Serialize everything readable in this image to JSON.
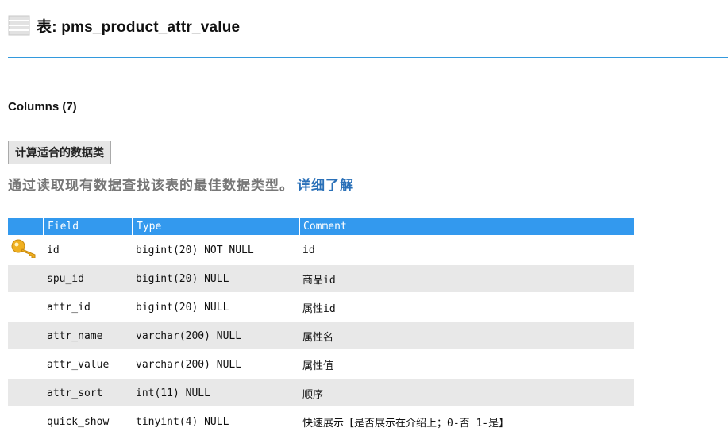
{
  "header": {
    "title": "表: pms_product_attr_value",
    "icon": "table-icon"
  },
  "columns_section": {
    "title": "Columns (7)"
  },
  "calc_button": {
    "label": "计算适合的数据类"
  },
  "description": {
    "text": "通过读取现有数据查找该表的最佳数据类型。",
    "link": "详细了解"
  },
  "colors": {
    "accent": "#3399ee",
    "divider": "#3399dd",
    "link": "#2a70b8",
    "row_alt": "#e8e8e8",
    "key_icon": "#f0b020"
  },
  "table": {
    "headers": [
      "Field",
      "Type",
      "Comment"
    ],
    "rows": [
      {
        "key": true,
        "field": "id",
        "type": "bigint(20) NOT NULL",
        "comment": "id"
      },
      {
        "key": false,
        "field": "spu_id",
        "type": "bigint(20) NULL",
        "comment": "商品id"
      },
      {
        "key": false,
        "field": "attr_id",
        "type": "bigint(20) NULL",
        "comment": "属性id"
      },
      {
        "key": false,
        "field": "attr_name",
        "type": "varchar(200) NULL",
        "comment": "属性名"
      },
      {
        "key": false,
        "field": "attr_value",
        "type": "varchar(200) NULL",
        "comment": "属性值"
      },
      {
        "key": false,
        "field": "attr_sort",
        "type": "int(11) NULL",
        "comment": "顺序"
      },
      {
        "key": false,
        "field": "quick_show",
        "type": "tinyint(4) NULL",
        "comment": "快速展示【是否展示在介绍上；0-否 1-是】"
      }
    ]
  }
}
